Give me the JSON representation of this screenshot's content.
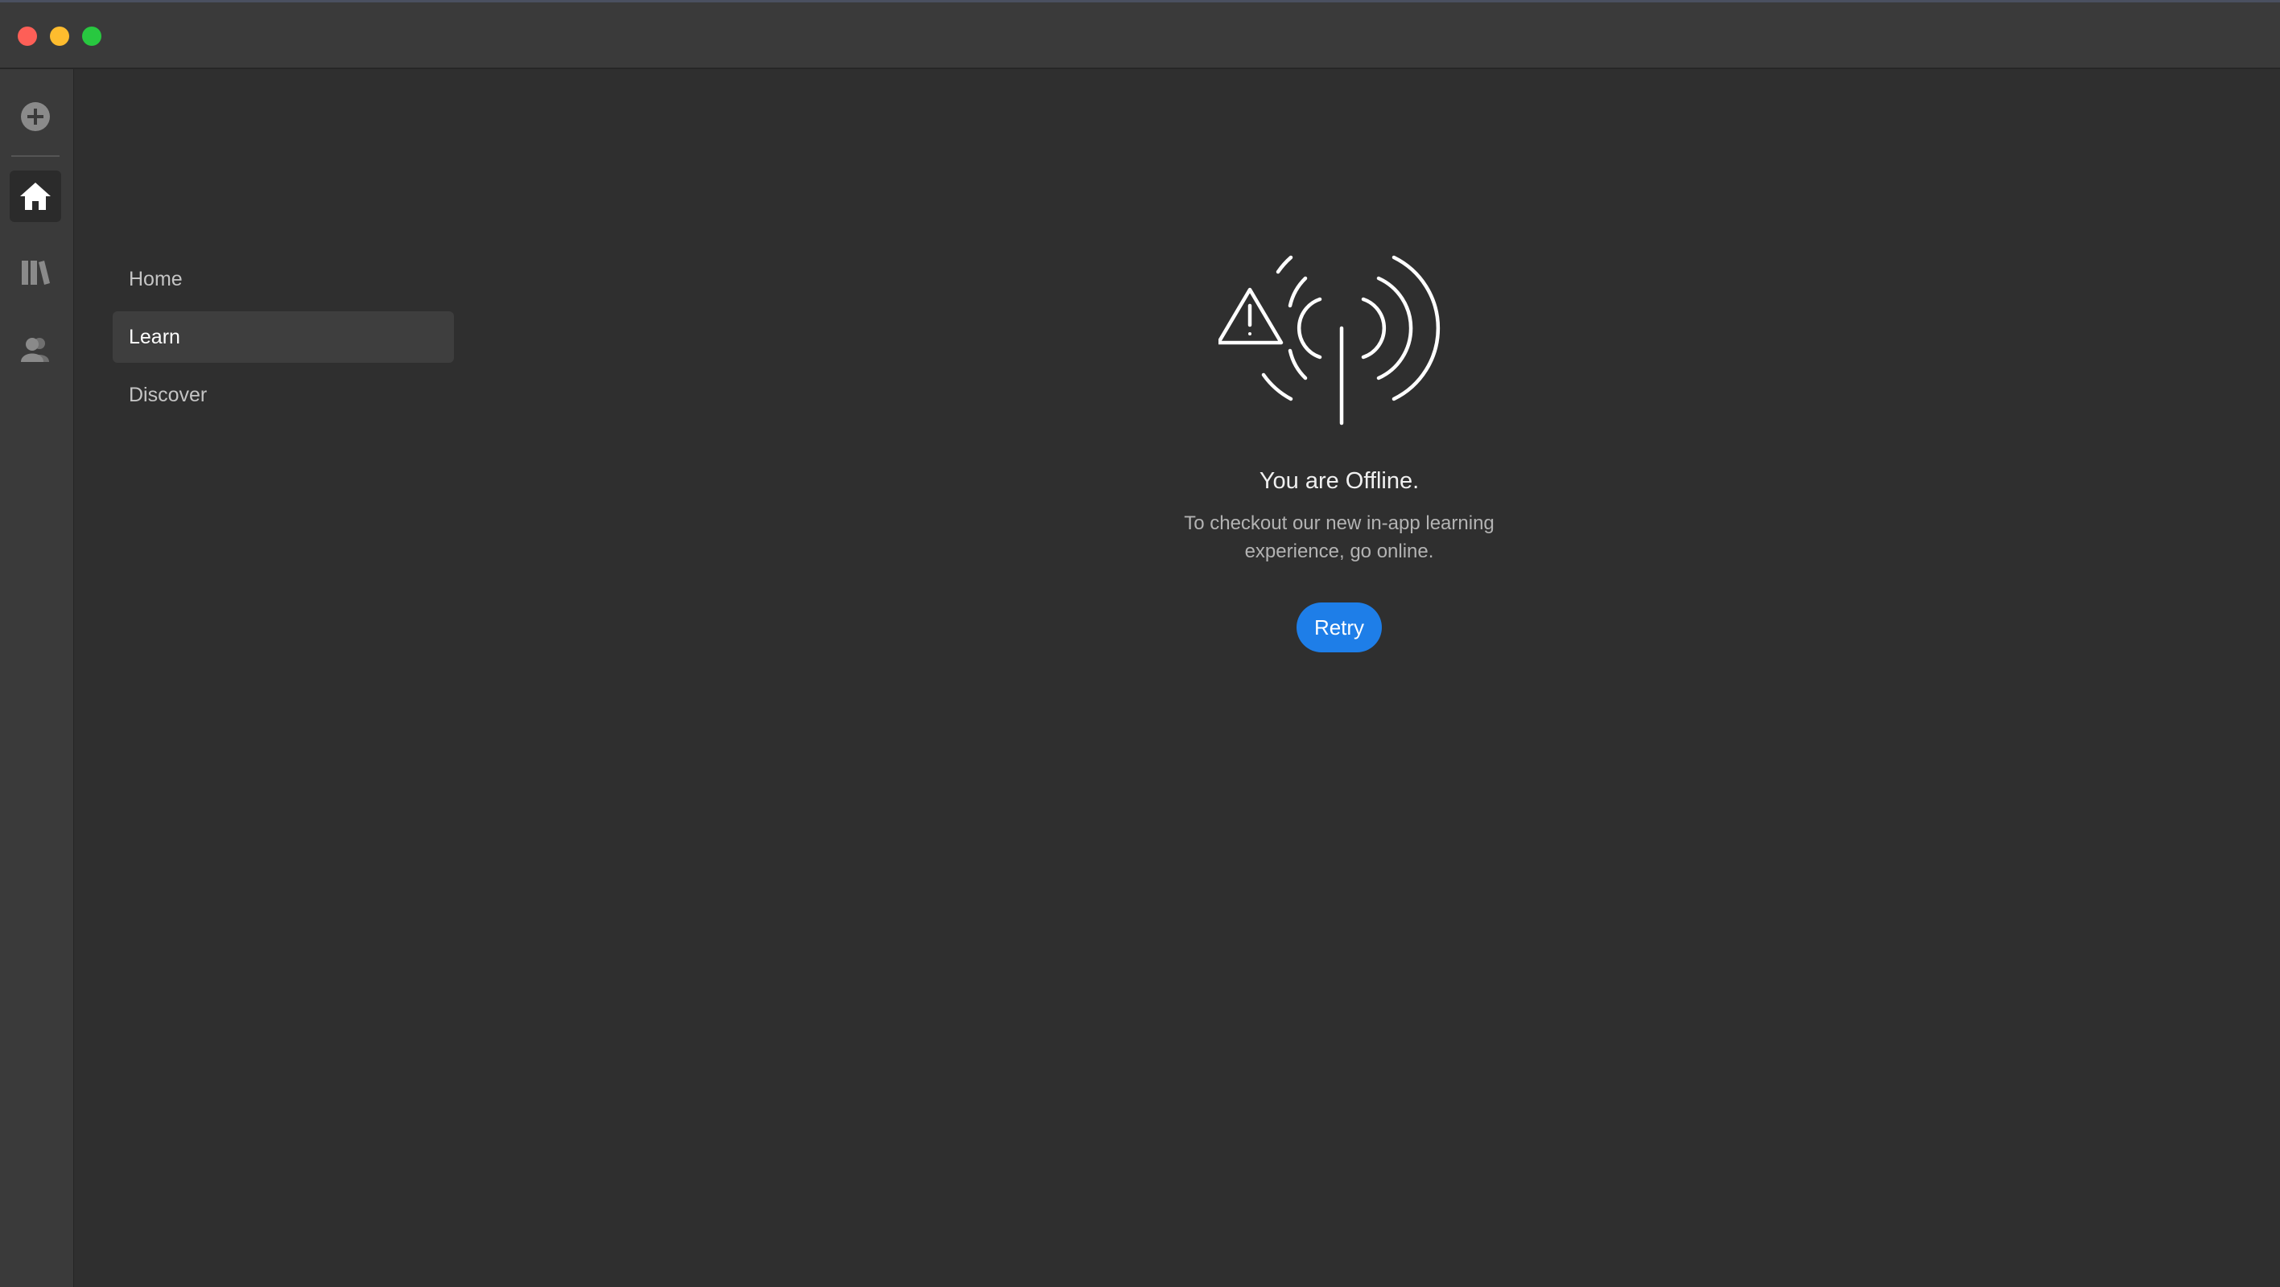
{
  "window": {
    "traffic_lights": [
      "close",
      "minimize",
      "zoom"
    ]
  },
  "rail": {
    "items": [
      {
        "icon": "plus-circle-icon",
        "active": false
      },
      {
        "icon": "home-icon",
        "active": true
      },
      {
        "icon": "library-icon",
        "active": false
      },
      {
        "icon": "users-icon",
        "active": false
      }
    ]
  },
  "nav": {
    "items": [
      {
        "label": "Home",
        "active": false
      },
      {
        "label": "Learn",
        "active": true
      },
      {
        "label": "Discover",
        "active": false
      }
    ]
  },
  "offline": {
    "icon": "offline-signal-warning-icon",
    "title": "You are Offline.",
    "description": "To checkout our new in-app learning experience, go online.",
    "retry_label": "Retry"
  },
  "colors": {
    "background": "#2f2f2f",
    "titlebar": "#3a3a3a",
    "rail": "#3a3a3a",
    "nav_active": "#3e3e3e",
    "accent": "#1e7ee8",
    "close": "#fe5f57",
    "minimize": "#febc2e",
    "zoom": "#28c840"
  }
}
